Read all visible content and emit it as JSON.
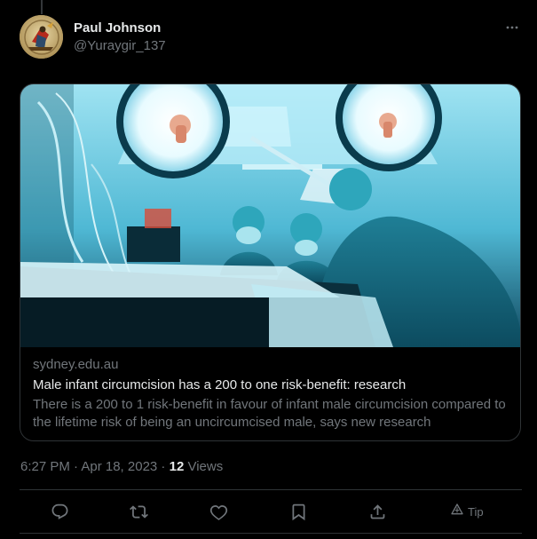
{
  "tweet": {
    "author": {
      "display_name": "Paul Johnson",
      "handle": "@Yuraygir_137"
    },
    "card": {
      "domain": "sydney.edu.au",
      "title": "Male infant circumcision has a 200 to one risk-benefit: research",
      "description": "There is a 200 to 1 risk-benefit in favour of infant male circumcision compared to the lifetime risk of being an uncircumcised male, says new research"
    },
    "meta": {
      "timestamp": "6:27 PM · Apr 18, 2023",
      "separator": " · ",
      "views_count": "12",
      "views_label": " Views"
    },
    "actions": {
      "tip_label": "Tip",
      "icons": [
        "reply-icon",
        "retweet-icon",
        "like-icon",
        "bookmark-icon",
        "share-icon",
        "tip-icon"
      ]
    }
  },
  "colors": {
    "background": "#000000",
    "primary_text": "#e7e9ea",
    "secondary_text": "#71767b",
    "border": "#2f3336"
  }
}
